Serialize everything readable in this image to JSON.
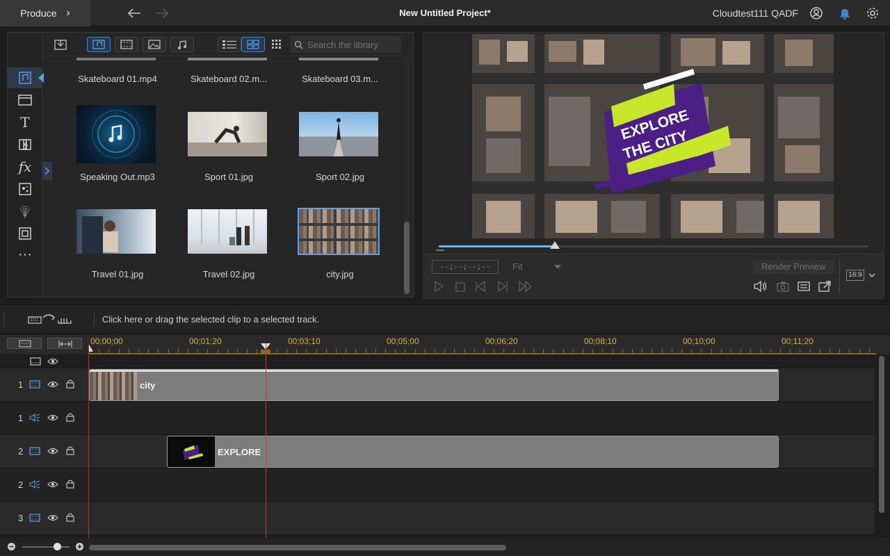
{
  "titlebar": {
    "produce_label": "Produce",
    "project_title": "New Untitled Project*",
    "user_name": "Cloudtest111 QADF"
  },
  "library": {
    "search_placeholder": "Search the library",
    "items": [
      {
        "label": "Skateboard 01.mp4"
      },
      {
        "label": "Skateboard 02.m..."
      },
      {
        "label": "Skateboard 03.m..."
      },
      {
        "label": "Speaking Out.mp3"
      },
      {
        "label": "Sport 01.jpg"
      },
      {
        "label": "Sport 02.jpg"
      },
      {
        "label": "Travel 01.jpg"
      },
      {
        "label": "Travel 02.jpg"
      },
      {
        "label": "city.jpg"
      }
    ]
  },
  "preview": {
    "overlay_line1": "EXPLORE",
    "overlay_line2": "THE CITY",
    "timecode": "--;--;--;--",
    "fit_label": "Fit",
    "render_label": "Render Preview",
    "aspect_label": "16:9",
    "position_fraction": 0.27
  },
  "timeline": {
    "hint": "Click here or drag the selected clip to a selected track.",
    "ticks": [
      "00;00;00",
      "00;01;20",
      "00;03;10",
      "00;05;00",
      "00;06;20",
      "00;08;10",
      "00;10;00",
      "00;11;20"
    ],
    "tracks": [
      {
        "num": "1",
        "type": "video",
        "clip": "city"
      },
      {
        "num": "1",
        "type": "audio",
        "clip": ""
      },
      {
        "num": "2",
        "type": "video",
        "clip": "EXPLORE"
      },
      {
        "num": "2",
        "type": "audio",
        "clip": ""
      },
      {
        "num": "3",
        "type": "video",
        "clip": ""
      }
    ]
  },
  "colors": {
    "accent": "#3b86d6",
    "ruler_text": "#d8b04a",
    "playhead": "#c03a3a",
    "overlay_purple": "#4b1f86",
    "overlay_lime": "#c8e62a"
  }
}
